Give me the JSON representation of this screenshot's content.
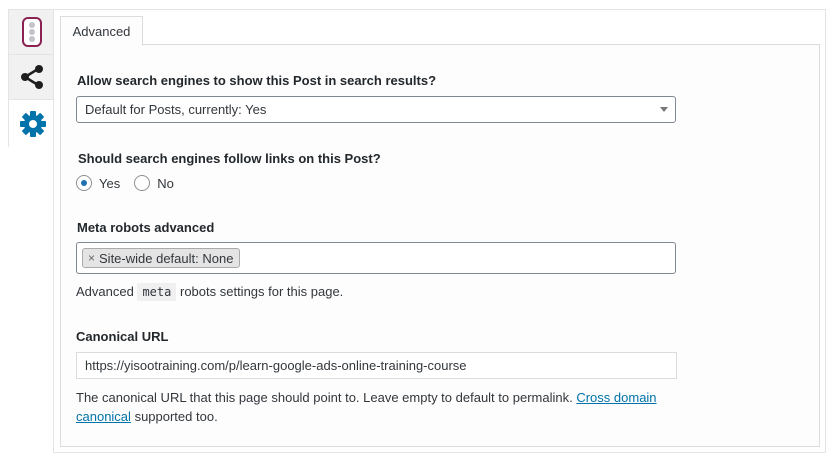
{
  "side_tabs": [
    {
      "icon": "traffic-light-icon",
      "color": "#8b2252"
    },
    {
      "icon": "share-icon",
      "color": "#1e1e1e"
    },
    {
      "icon": "gear-icon",
      "color": "#0073aa"
    }
  ],
  "panel": {
    "tab_label": "Advanced",
    "search_results": {
      "label": "Allow search engines to show this Post in search results?",
      "selected": "Default for Posts, currently: Yes"
    },
    "follow_links": {
      "label": "Should search engines follow links on this Post?",
      "options": [
        "Yes",
        "No"
      ],
      "selected": "Yes"
    },
    "meta_robots": {
      "label": "Meta robots advanced",
      "chip_label": "Site-wide default: None",
      "chip_remove": "×",
      "help_before": "Advanced",
      "help_code": "meta",
      "help_after": "robots settings for this page."
    },
    "canonical": {
      "label": "Canonical URL",
      "value": "https://yisootraining.com/p/learn-google-ads-online-training-course",
      "help_text": "The canonical URL that this page should point to. Leave empty to default to permalink.",
      "help_link_1": "Cross domain",
      "help_link_2": "canonical",
      "help_suffix": "supported too."
    }
  }
}
